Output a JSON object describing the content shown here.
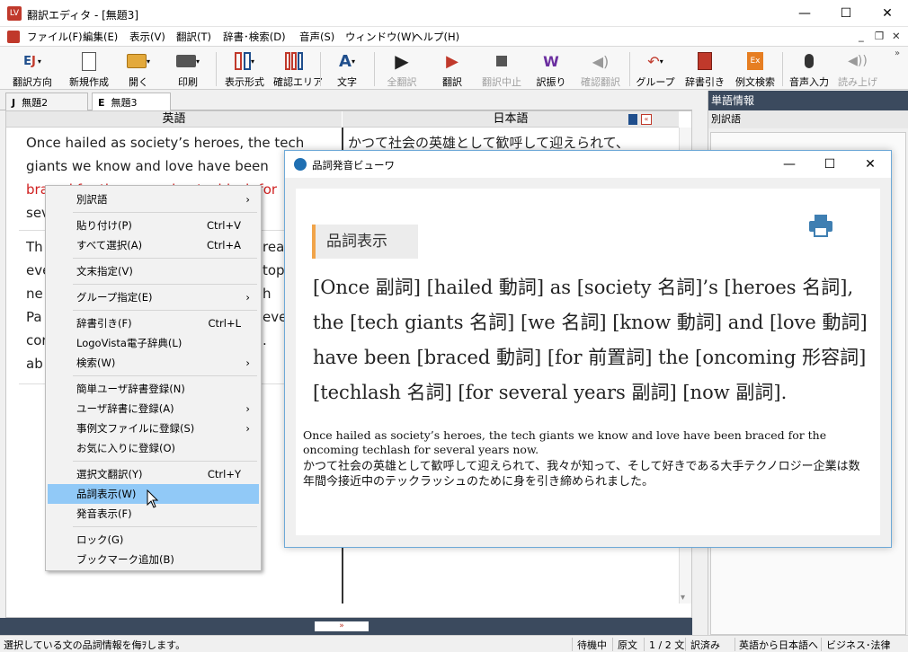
{
  "window": {
    "title": "翻訳エディタ - [無題3]",
    "icon_label": "LV",
    "min": "—",
    "max": "☐",
    "close": "✕"
  },
  "menu": [
    "ファイル(F)",
    "編集(E)",
    "表示(V)",
    "翻訳(T)",
    "辞書･検索(D)",
    "音声(S)",
    "ウィンドウ(W)",
    "ヘルプ(H)"
  ],
  "mdi": {
    "min": "_",
    "restore": "❐",
    "close": "✕"
  },
  "toolbar": [
    {
      "label": "翻訳方向",
      "icon": "EJ",
      "dis": false
    },
    {
      "label": "新規作成",
      "icon": "doc",
      "dis": false
    },
    {
      "label": "開く",
      "icon": "open",
      "dis": false
    },
    {
      "label": "印刷",
      "icon": "print",
      "dis": false
    },
    {
      "label": "表示形式",
      "icon": "cols",
      "dis": false
    },
    {
      "label": "確認エリア",
      "icon": "cols3",
      "dis": false
    },
    {
      "label": "文字",
      "icon": "A",
      "dis": false
    },
    {
      "label": "全翻訳",
      "icon": "play",
      "dis": true
    },
    {
      "label": "翻訳",
      "icon": "play2",
      "dis": false
    },
    {
      "label": "翻訳中止",
      "icon": "stop",
      "dis": true
    },
    {
      "label": "訳振り",
      "icon": "W",
      "dis": false
    },
    {
      "label": "確認翻訳",
      "icon": "spk",
      "dis": true
    },
    {
      "label": "グループ",
      "icon": "grp",
      "dis": false
    },
    {
      "label": "辞書引き",
      "icon": "dict",
      "dis": false
    },
    {
      "label": "例文検索",
      "icon": "ex",
      "dis": false
    },
    {
      "label": "音声入力",
      "icon": "mic",
      "dis": false
    },
    {
      "label": "読み上げ",
      "icon": "read",
      "dis": true
    }
  ],
  "tabs": [
    {
      "label": "無題2",
      "prefix": "J"
    },
    {
      "label": "無題3",
      "prefix": "E"
    }
  ],
  "editor": {
    "left_header": "英語",
    "right_header": "日本語",
    "left_lines": [
      "Once hailed as society’s heroes, the tech",
      "giants we know and love have been",
      "braced for the oncoming techlash for",
      "sev"
    ],
    "left_lines2": [
      "Th",
      "eve",
      "ne",
      "Pa",
      "cor",
      "ab"
    ],
    "left_lines2_tail": [
      "reas",
      "top",
      "h",
      "eve",
      "",
      ". "
    ],
    "right_line": "かつて社会の英雄として歓呼して迎えられて、"
  },
  "context_menu": [
    {
      "label": "別訳語",
      "shortcut": "",
      "arrow": true
    },
    {
      "label": "貼り付け(P)",
      "shortcut": "Ctrl+V",
      "arrow": false
    },
    {
      "label": "すべて選択(A)",
      "shortcut": "Ctrl+A",
      "arrow": false
    },
    {
      "label": "文末指定(V)",
      "shortcut": "",
      "arrow": false
    },
    {
      "label": "グループ指定(E)",
      "shortcut": "",
      "arrow": true
    },
    {
      "label": "辞書引き(F)",
      "shortcut": "Ctrl+L",
      "arrow": false
    },
    {
      "label": "LogoVista電子辞典(L)",
      "shortcut": "",
      "arrow": false
    },
    {
      "label": "検索(W)",
      "shortcut": "",
      "arrow": true
    },
    {
      "label": "簡単ユーザ辞書登録(N)",
      "shortcut": "",
      "arrow": false
    },
    {
      "label": "ユーザ辞書に登録(A)",
      "shortcut": "",
      "arrow": true
    },
    {
      "label": "事例文ファイルに登録(S)",
      "shortcut": "",
      "arrow": true
    },
    {
      "label": "お気に入りに登録(O)",
      "shortcut": "",
      "arrow": false
    },
    {
      "label": "選択文翻訳(Y)",
      "shortcut": "Ctrl+Y",
      "arrow": false
    },
    {
      "label": "品詞表示(W)",
      "shortcut": "",
      "arrow": false
    },
    {
      "label": "発音表示(F)",
      "shortcut": "",
      "arrow": false
    },
    {
      "label": "ロック(G)",
      "shortcut": "",
      "arrow": false
    },
    {
      "label": "ブックマーク追加(B)",
      "shortcut": "",
      "arrow": false
    }
  ],
  "viewer": {
    "title": "品詞発音ビューワ",
    "heading": "品詞表示",
    "pos_lines": [
      "[Once 副詞] [hailed 動詞] as [society 名詞]’s [heroes 名詞],",
      "the [tech giants 名詞] [we 名詞] [know 動詞] and [love 動詞]",
      "have been [braced 動詞] [for 前置詞] the [oncoming 形容詞]",
      "[techlash 名詞] [for several years 副詞] [now 副詞]."
    ],
    "source": "Once hailed as society’s heroes, the tech giants we know and love have been braced for the oncoming techlash for several years now.",
    "translation": "かつて社会の英雄として歓呼して迎えられて、我々が知って、そして好きである大手テクノロジー企業は数年間今接近中のテックラッシュのために身を引き締められました。"
  },
  "right_panel": {
    "title": "単語情報",
    "subtitle": "別訳語"
  },
  "status": {
    "message": "選択している文の品詞情報を侮ｦします。",
    "items": [
      "待機中",
      "原文",
      "1 / 2 文",
      "訳済み",
      "英語から日本語へ",
      "ビジネス･法律"
    ]
  }
}
